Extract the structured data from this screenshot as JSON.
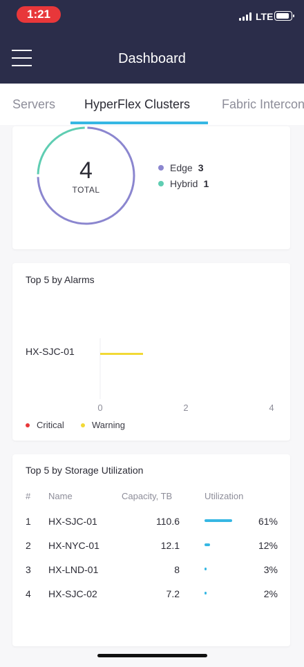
{
  "status": {
    "time": "1:21",
    "network": "LTE"
  },
  "header": {
    "title": "Dashboard",
    "menu_icon": "hamburger-menu-icon"
  },
  "tabs": [
    {
      "label": "Servers"
    },
    {
      "label": "HyperFlex Clusters",
      "active": true
    },
    {
      "label": "Fabric Interconnects"
    }
  ],
  "summary": {
    "total": "4",
    "total_label": "TOTAL",
    "legend": [
      {
        "label": "Edge",
        "count": "3",
        "color": "#8b86cf"
      },
      {
        "label": "Hybrid",
        "count": "1",
        "color": "#5fcdb2"
      }
    ]
  },
  "alarms": {
    "title": "Top 5 by Alarms",
    "legend": [
      {
        "label": "Critical",
        "color": "#e8373a"
      },
      {
        "label": "Warning",
        "color": "#f2d935"
      }
    ]
  },
  "chart_data": {
    "type": "bar",
    "orientation": "horizontal",
    "categories": [
      "HX-SJC-01"
    ],
    "series": [
      {
        "name": "Critical",
        "values": [
          0
        ]
      },
      {
        "name": "Warning",
        "values": [
          1
        ]
      }
    ],
    "xlim": [
      0,
      4
    ],
    "xticks": [
      "0",
      "2",
      "4"
    ]
  },
  "storage": {
    "title": "Top 5 by Storage Utilization",
    "columns": [
      "#",
      "Name",
      "Capacity, TB",
      "Utilization"
    ],
    "rows": [
      {
        "rank": "1",
        "name": "HX-SJC-01",
        "capacity": "110.6",
        "utilization": "61%",
        "fraction": 0.61
      },
      {
        "rank": "2",
        "name": "HX-NYC-01",
        "capacity": "12.1",
        "utilization": "12%",
        "fraction": 0.12
      },
      {
        "rank": "3",
        "name": "HX-LND-01",
        "capacity": "8",
        "utilization": "3%",
        "fraction": 0.03
      },
      {
        "rank": "4",
        "name": "HX-SJC-02",
        "capacity": "7.2",
        "utilization": "2%",
        "fraction": 0.02
      }
    ]
  },
  "colors": {
    "header_bg": "#2b2d4a",
    "accent": "#36b7e3",
    "time_pill": "#e8373a"
  }
}
